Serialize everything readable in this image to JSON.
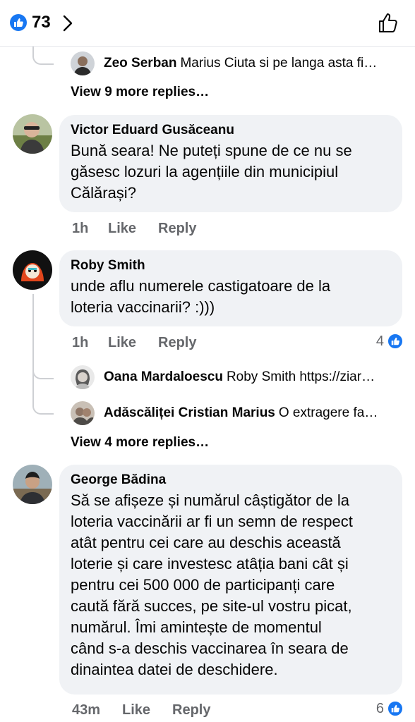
{
  "header": {
    "like_count": "73",
    "icons": [
      "like-reaction-icon",
      "chevron-right-icon",
      "thumbs-up-outline-icon"
    ],
    "accent_color": "#1877f2"
  },
  "thread1": {
    "reply": {
      "author": "Zeo Serban",
      "text": "Marius Ciuta si pe langa asta fi…"
    },
    "more_replies": "View 9 more replies…"
  },
  "comments": [
    {
      "author": "Victor Eduard Gusăceanu",
      "lines": [
        "Bună seara! Ne puteți spune de ce nu se",
        "găsesc lozuri la agențiile din municipiul",
        "Călărași?"
      ],
      "time": "1h",
      "like": "Like",
      "reply": "Reply"
    },
    {
      "author": "Roby Smith",
      "lines": [
        "unde aflu numerele castigatoare de la",
        "loteria vaccinarii? :)))"
      ],
      "time": "1h",
      "like": "Like",
      "reply": "Reply",
      "reactions": "4",
      "replies": [
        {
          "author": "Oana Mardaloescu",
          "text": "Roby Smith https://ziar…"
        },
        {
          "author": "Adăscăliței Cristian Marius",
          "text": "O extragere fa…"
        }
      ],
      "more_replies": "View 4 more replies…"
    },
    {
      "author": "George Bădina",
      "lines": [
        "Să se afișeze și numărul câștigător de la",
        "loteria vaccinării ar fi un semn de respect",
        "atât pentru cei care au deschis această",
        "loterie și care investesc atâția bani cât și",
        "pentru cei 500 000 de participanți care",
        "caută fără succes, pe site-ul vostru picat,",
        "numărul. Îmi amintește de momentul",
        "când s-a deschis vaccinarea în seara de",
        "dinaintea datei de deschidere."
      ],
      "time": "43m",
      "like": "Like",
      "reply": "Reply",
      "reactions": "6"
    }
  ]
}
